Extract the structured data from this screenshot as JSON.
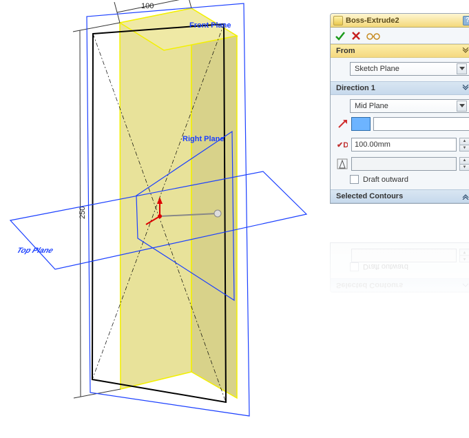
{
  "viewport": {
    "dim_width": "100",
    "dim_height": "250",
    "plane_front": "Front Plane",
    "plane_right": "Right Plane",
    "plane_top": "Top Plane"
  },
  "panel": {
    "title": "Boss-Extrude2",
    "from": {
      "header": "From",
      "value": "Sketch Plane"
    },
    "direction1": {
      "header": "Direction 1",
      "end_condition": "Mid Plane",
      "depth": "100.00mm",
      "draft_value": "",
      "draft_outward_label": "Draft outward"
    },
    "selected_contours": {
      "header": "Selected Contours"
    }
  }
}
